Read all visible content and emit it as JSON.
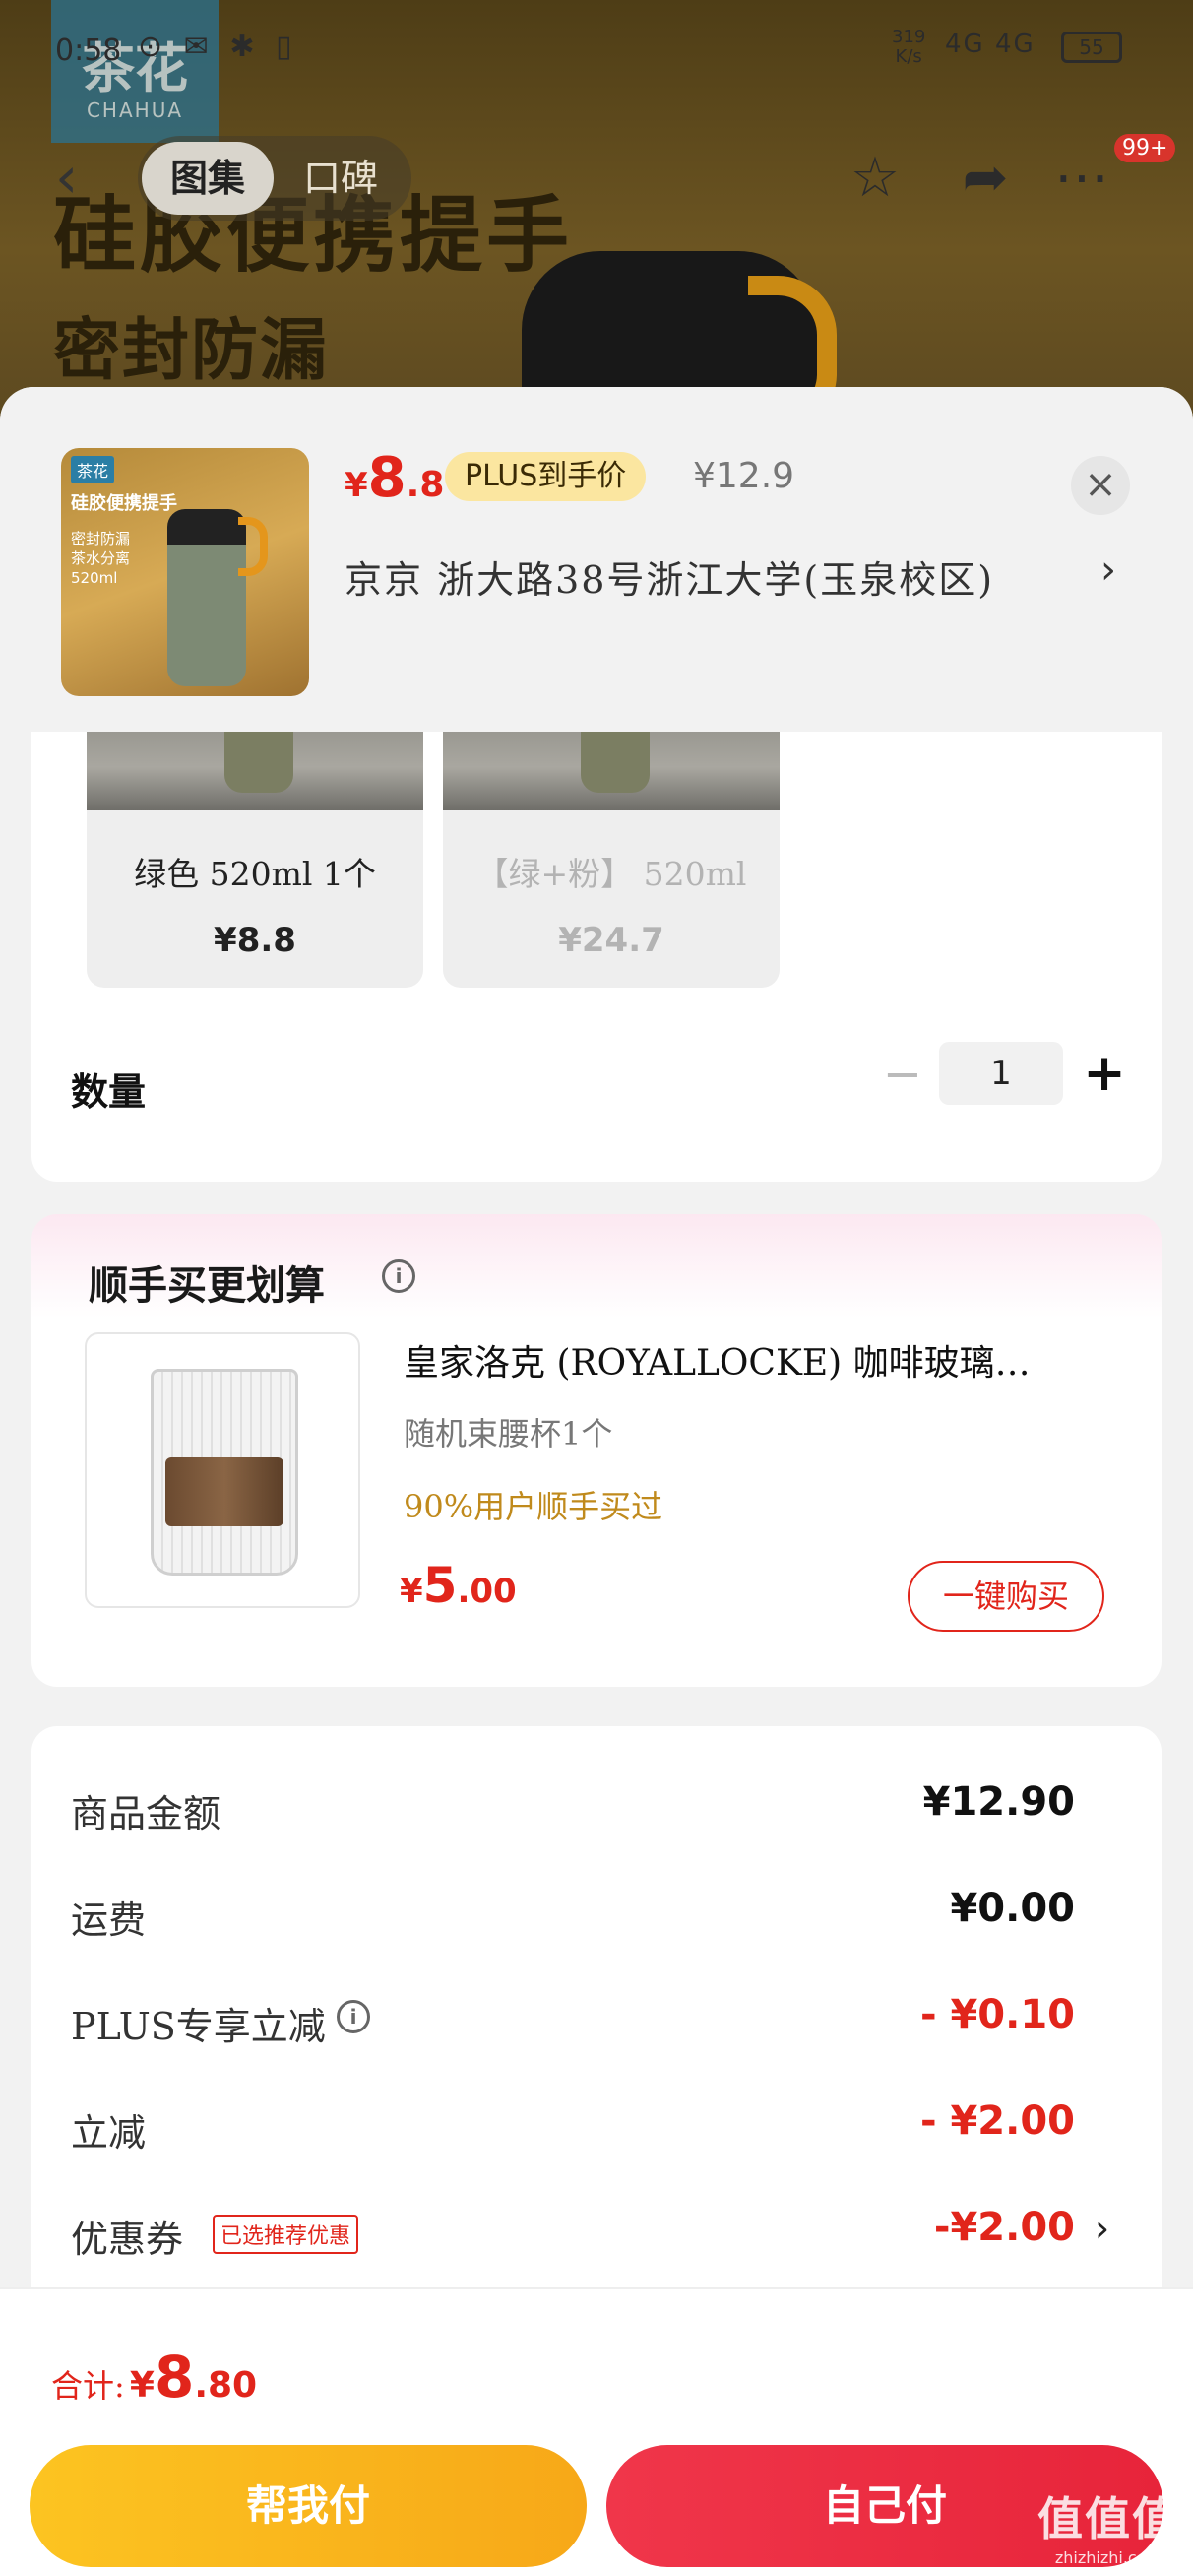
{
  "status_bar": {
    "time": "0:58",
    "net_speed": "319\nK/s",
    "signal": "4G 4G",
    "battery": "55"
  },
  "background_page": {
    "logo_text": "茶花",
    "logo_sub": "CHAHUA",
    "headline": "硅胶便携提手",
    "sub1": "密封防漏",
    "sub2": "茶水分离",
    "tabs": [
      "图集",
      "口碑"
    ],
    "badge": "99+"
  },
  "sheet": {
    "price": {
      "currency": "¥",
      "int": "8",
      "dec": ".8"
    },
    "plus_tag": "PLUS到手价",
    "original_price": "¥12.9",
    "close": "×",
    "address": "京京   浙大路38号浙江大学(玉泉校区)",
    "address_chevron": "›",
    "thumb": {
      "brand": "茶花",
      "title": "硅胶便携提手",
      "lines": "密封防漏\n茶水分离\n520ml"
    }
  },
  "variants": [
    {
      "name": "绿色 520ml 1个",
      "price": "¥8.8",
      "disabled": false
    },
    {
      "name": "【绿+粉】 520ml",
      "price": "¥24.7",
      "disabled": true
    }
  ],
  "quantity": {
    "label": "数量",
    "minus": "−",
    "value": "1",
    "plus": "+"
  },
  "bundle": {
    "title": "顺手买更划算",
    "product_name": "皇家洛克 (ROYALLOCKE) 咖啡玻璃…",
    "desc": "随机束腰杯1个",
    "social_proof": "90%用户顺手买过",
    "price": {
      "currency": "¥",
      "int": "5",
      "dec": ".00"
    },
    "buy_label": "一键购买"
  },
  "summary": [
    {
      "label": "商品金额",
      "value": "¥12.90",
      "red": false
    },
    {
      "label": "运费",
      "value": "¥0.00",
      "red": false
    },
    {
      "label": "PLUS专享立减",
      "value": "- ¥0.10",
      "red": true
    },
    {
      "label": "立减",
      "value": "- ¥2.00",
      "red": true
    },
    {
      "label": "优惠券",
      "tag": "已选推荐优惠",
      "value": "-¥2.00",
      "red": true
    }
  ],
  "footer": {
    "total_label": "合计:",
    "total": {
      "currency": "¥",
      "int": "8",
      "dec": ".80"
    },
    "help_pay": "帮我付",
    "self_pay": "自己付"
  },
  "watermark": {
    "main": "值值值",
    "sub": "zhizhizhi.com"
  },
  "colors": {
    "accent_red": "#e1251b",
    "plus_gold": "#fbe6a0",
    "help_yellow": "#fcc421",
    "self_red": "#f0364a"
  }
}
